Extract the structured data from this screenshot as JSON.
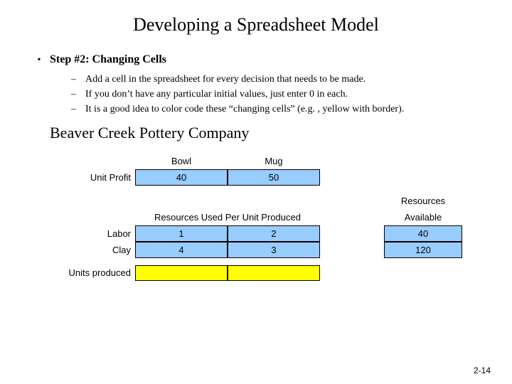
{
  "title": "Developing a Spreadsheet Model",
  "step_heading": "Step #2: Changing Cells",
  "sub_bullets": [
    "Add a cell in the spreadsheet for every decision that needs to be made.",
    "If you don’t have any particular initial values, just enter 0 in each.",
    "It is a good idea to color code these “changing cells” (e.g. , yellow with border)."
  ],
  "company": "Beaver Creek Pottery Company",
  "table": {
    "col_headers": [
      "Bowl",
      "Mug"
    ],
    "unit_profit_label": "Unit Profit",
    "unit_profit": [
      "40",
      "50"
    ],
    "resources_label": "Resources",
    "per_unit_label": "Resources Used Per Unit Produced",
    "available_label": "Available",
    "rows": [
      {
        "label": "Labor",
        "vals": [
          "1",
          "2"
        ],
        "avail": "40"
      },
      {
        "label": "Clay",
        "vals": [
          "4",
          "3"
        ],
        "avail": "120"
      }
    ],
    "units_produced_label": "Units produced"
  },
  "page_number": "2-14",
  "chart_data": {
    "type": "table",
    "title": "Beaver Creek Pottery Company",
    "columns": [
      "Bowl",
      "Mug"
    ],
    "unit_profit": [
      40,
      50
    ],
    "resources": [
      {
        "name": "Labor",
        "per_unit": [
          1,
          2
        ],
        "available": 40
      },
      {
        "name": "Clay",
        "per_unit": [
          4,
          3
        ],
        "available": 120
      }
    ],
    "decision_vars": [
      "Units produced (Bowl)",
      "Units produced (Mug)"
    ]
  }
}
